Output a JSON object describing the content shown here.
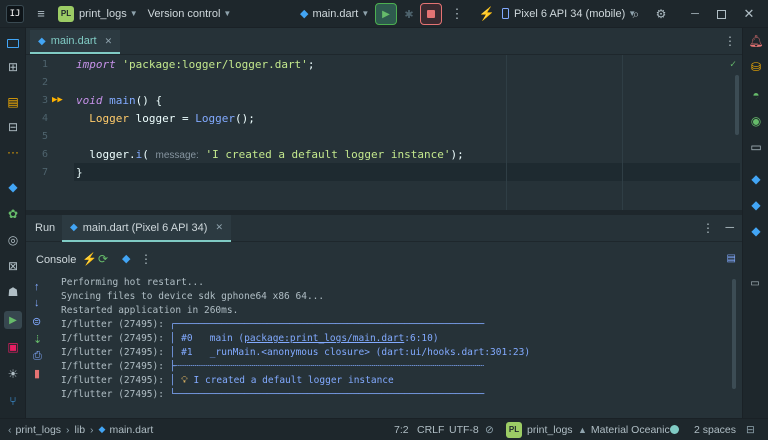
{
  "titlebar": {
    "project_badge": "PL",
    "project_name": "print_logs",
    "vcs_label": "Version control",
    "run_config": "main.dart",
    "device": "Pixel 6 API 34 (mobile)"
  },
  "editor": {
    "tab_label": "main.dart",
    "lines": [
      {
        "num": "1"
      },
      {
        "num": "2"
      },
      {
        "num": "3"
      },
      {
        "num": "4"
      },
      {
        "num": "5"
      },
      {
        "num": "6"
      },
      {
        "num": "7"
      }
    ],
    "code": {
      "l1_kw": "import",
      "l1_str": "'package:logger/logger.dart'",
      "l1_end": ";",
      "l3_kw": "void",
      "l3_fn": "main",
      "l3_rest": "() {",
      "l4_type": "Logger",
      "l4_var": " logger = ",
      "l4_ctor": "Logger",
      "l4_end": "();",
      "l6_obj": "logger.",
      "l6_fn": "i",
      "l6_open": "(",
      "l6_hint": "message:",
      "l6_str": "'I created a default logger instance'",
      "l6_end": ");",
      "l7": "}"
    }
  },
  "run": {
    "title": "Run",
    "tab_label": "main.dart (Pixel 6 API 34)",
    "console_label": "Console",
    "output": [
      "Performing hot restart...",
      "Syncing files to device sdk gphone64 x86 64...",
      "Restarted application in 260ms."
    ],
    "flutter_prefix": "I/flutter (27495):",
    "frame0_num": "#0",
    "frame0_pre": "main (",
    "frame0_link": "package:print_logs/main.dart",
    "frame0_post": ":6:10)",
    "frame1_num": "#1",
    "frame1_text": "_runMain.<anonymous closure> (dart:ui/hooks.dart:301:23)",
    "log_message": "I created a default logger instance"
  },
  "status": {
    "breadcrumb": [
      "print_logs",
      "lib",
      "main.dart"
    ],
    "position": "7:2",
    "line_ending": "CRLF",
    "encoding": "UTF-8",
    "project_badge": "PL",
    "project": "print_logs",
    "theme": "Material Oceanic",
    "indent": "2 spaces"
  }
}
